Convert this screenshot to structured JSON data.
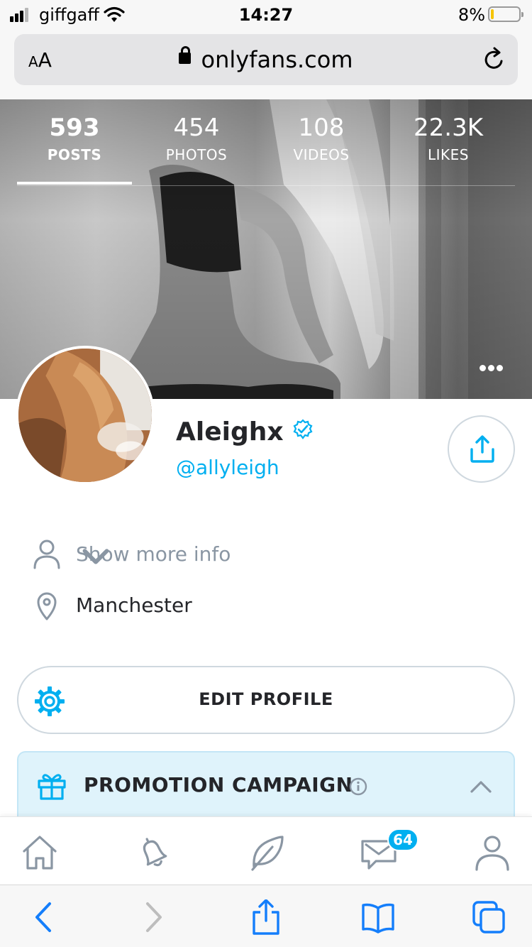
{
  "status_bar": {
    "carrier": "giffgaff",
    "time": "14:27",
    "battery_percent": "8%",
    "battery_level": 0.08,
    "signal_bars": 3
  },
  "browser": {
    "text_size_label_small": "A",
    "text_size_label_large": "A",
    "url": "onlyfans.com",
    "icons": [
      "lock-icon",
      "reload-icon",
      "back-icon",
      "forward-icon",
      "share-icon",
      "bookmarks-icon",
      "tabs-icon"
    ]
  },
  "profile": {
    "stats": [
      {
        "value": "593",
        "label": "POSTS",
        "active": true
      },
      {
        "value": "454",
        "label": "PHOTOS",
        "active": false
      },
      {
        "value": "108",
        "label": "VIDEOS",
        "active": false
      },
      {
        "value": "22.3K",
        "label": "LIKES",
        "active": false
      }
    ],
    "name": "Aleighx",
    "handle": "@allyleigh",
    "verified": true,
    "show_more_info": "Show more info",
    "location": "Manchester",
    "edit_profile_label": "EDIT PROFILE",
    "promotion_label": "PROMOTION CAMPAIGN"
  },
  "bottom_nav": {
    "items": [
      "home-icon",
      "bell-icon",
      "feather-icon",
      "messages-icon",
      "user-icon"
    ],
    "messages_badge": "64"
  },
  "colors": {
    "accent": "#00aff0",
    "text": "#242529",
    "muted": "#8a96a3",
    "promo_bg": "#dff3fb",
    "battery": "#f6c400"
  }
}
